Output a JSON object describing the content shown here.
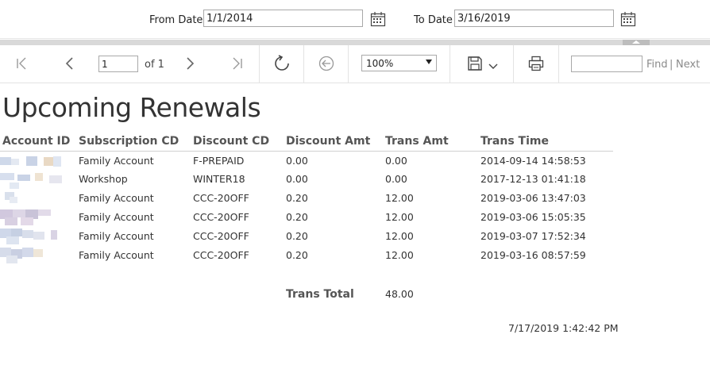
{
  "params": {
    "from_label": "From Date",
    "from_value": "1/1/2014",
    "to_label": "To Date",
    "to_value": "3/16/2019"
  },
  "toolbar": {
    "page_value": "1",
    "of_label": "of 1",
    "zoom_value": "100%",
    "find_label": "Find",
    "sep": "|",
    "next_label": "Next"
  },
  "report": {
    "title": "Upcoming Renewals",
    "columns": [
      "Account ID",
      "Subscription CD",
      "Discount CD",
      "Discount Amt",
      "Trans Amt",
      "Trans Time"
    ],
    "rows": [
      {
        "subscription": "Family Account",
        "discount_cd": "F-PREPAID",
        "discount_amt": "0.00",
        "trans_amt": "0.00",
        "trans_time": "2014-09-14 14:58:53"
      },
      {
        "subscription": "Workshop",
        "discount_cd": "WINTER18",
        "discount_amt": "0.00",
        "trans_amt": "0.00",
        "trans_time": "2017-12-13 01:41:18"
      },
      {
        "subscription": "Family Account",
        "discount_cd": "CCC-20OFF",
        "discount_amt": "0.20",
        "trans_amt": "12.00",
        "trans_time": "2019-03-06 13:47:03"
      },
      {
        "subscription": "Family Account",
        "discount_cd": "CCC-20OFF",
        "discount_amt": "0.20",
        "trans_amt": "12.00",
        "trans_time": "2019-03-06 15:05:35"
      },
      {
        "subscription": "Family Account",
        "discount_cd": "CCC-20OFF",
        "discount_amt": "0.20",
        "trans_amt": "12.00",
        "trans_time": "2019-03-07 17:52:34"
      },
      {
        "subscription": "Family Account",
        "discount_cd": "CCC-20OFF",
        "discount_amt": "0.20",
        "trans_amt": "12.00",
        "trans_time": "2019-03-16 08:57:59"
      }
    ],
    "total_label": "Trans Total",
    "total_value": "48.00",
    "timestamp": "7/17/2019 1:42:42 PM"
  },
  "colors": {
    "header_text": "#555555",
    "pixelated": [
      "#c9d3e6",
      "#dfe6f2",
      "#e9d9c4",
      "#d7cfe3",
      "#cfd9ea",
      "#efe3d2"
    ]
  },
  "icons": [
    "calendar-icon",
    "first-page-icon",
    "previous-page-icon",
    "next-page-icon",
    "last-page-icon",
    "refresh-icon",
    "back-icon",
    "save-icon",
    "chevron-down-icon",
    "print-icon"
  ]
}
